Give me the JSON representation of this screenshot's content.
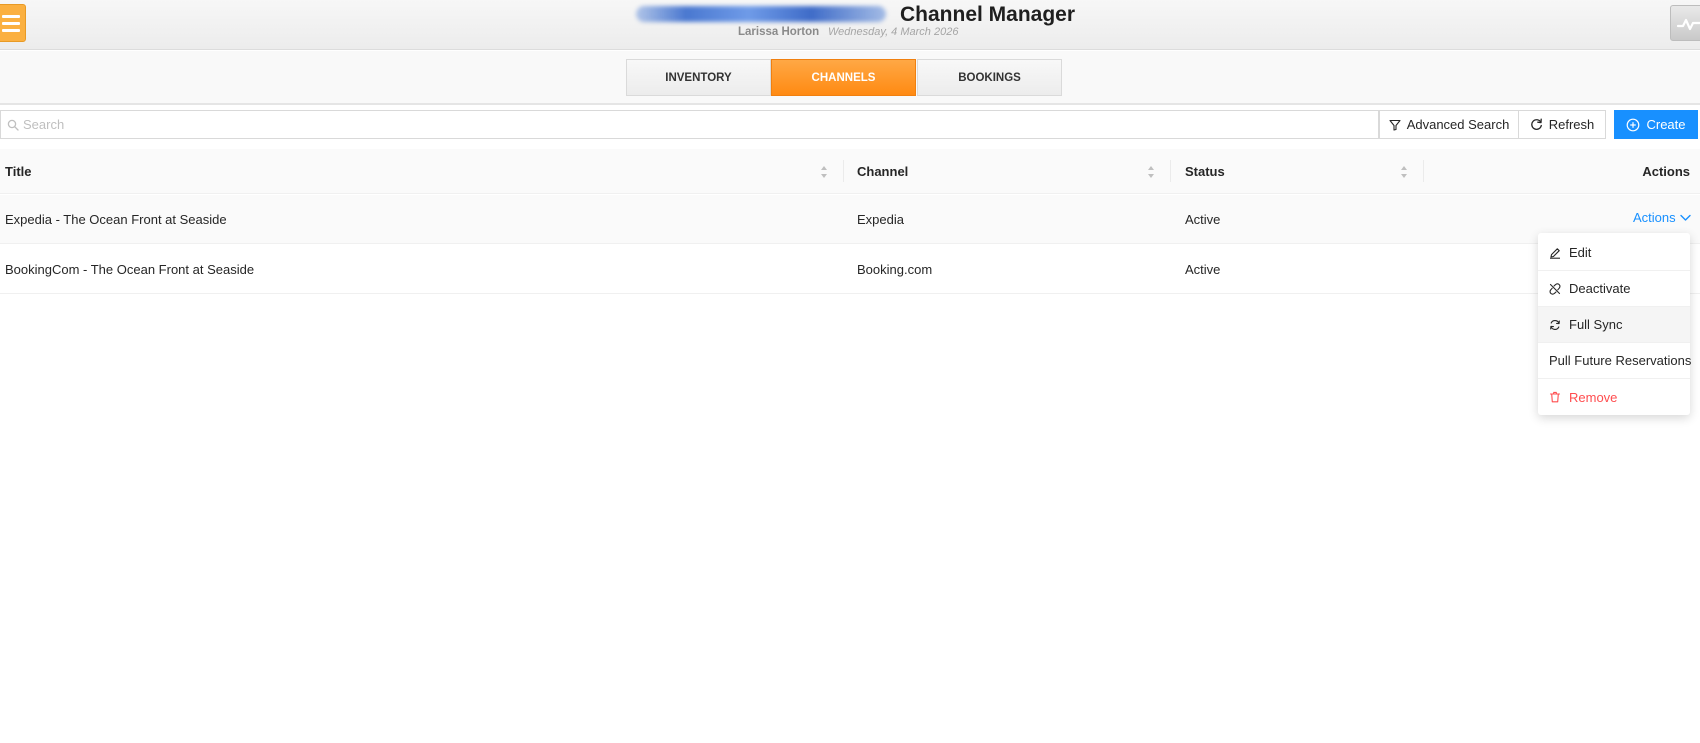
{
  "header": {
    "title": "Channel Manager",
    "user_name": "Larissa Horton",
    "date": "Wednesday, 4 March 2026"
  },
  "tabs": [
    {
      "label": "INVENTORY",
      "active": false
    },
    {
      "label": "CHANNELS",
      "active": true
    },
    {
      "label": "BOOKINGS",
      "active": false
    }
  ],
  "toolbar": {
    "search_placeholder": "Search",
    "search_value": "",
    "advanced_search_label": "Advanced Search",
    "refresh_label": "Refresh",
    "create_label": "Create"
  },
  "table": {
    "columns": [
      "Title",
      "Channel",
      "Status",
      "Actions"
    ],
    "rows": [
      {
        "title": "Expedia - The Ocean Front at Seaside",
        "channel": "Expedia",
        "status": "Active"
      },
      {
        "title": "BookingCom - The Ocean Front at Seaside",
        "channel": "Booking.com",
        "status": "Active"
      }
    ],
    "actions_link_label": "Actions"
  },
  "dropdown": {
    "items": [
      {
        "label": "Edit",
        "icon": "edit-icon"
      },
      {
        "label": "Deactivate",
        "icon": "unlink-icon"
      },
      {
        "label": "Full Sync",
        "icon": "sync-icon"
      },
      {
        "label": "Pull Future Reservations",
        "icon": ""
      },
      {
        "label": "Remove",
        "icon": "delete-icon"
      }
    ]
  },
  "colors": {
    "accent_orange": "#ff8a12",
    "primary_blue": "#1890ff",
    "danger_red": "#ff4d4f",
    "menu_button": "#fbb040"
  }
}
